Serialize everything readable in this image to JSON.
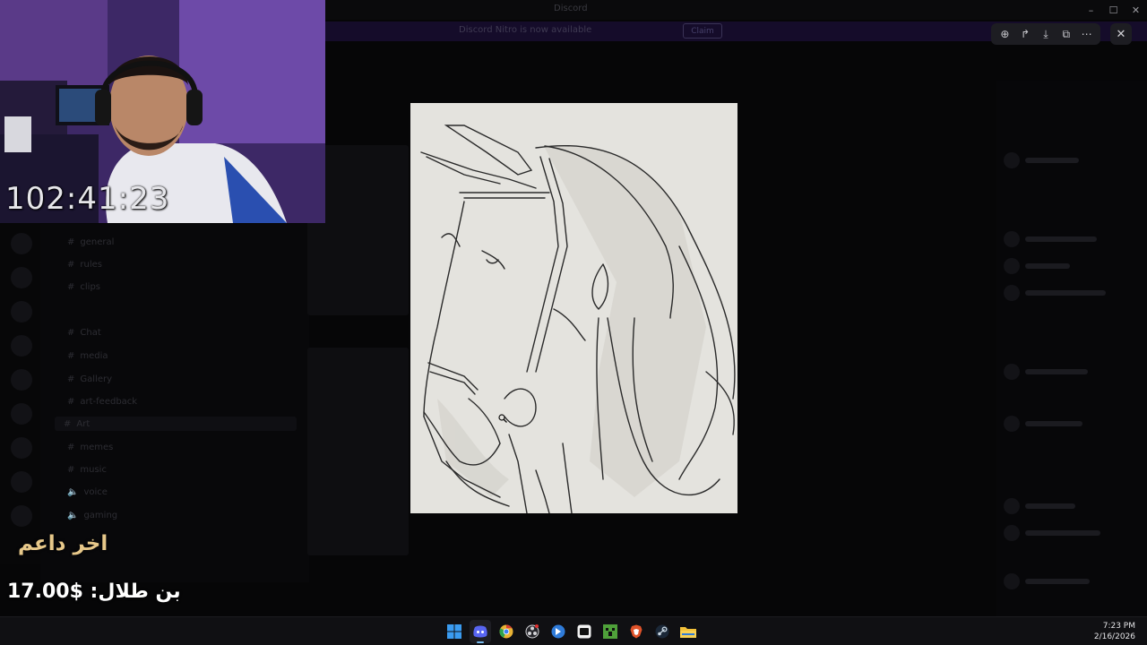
{
  "window": {
    "app_name": "Discord",
    "controls": [
      "minimize",
      "maximize",
      "close"
    ]
  },
  "banner": {
    "text": "Discord Nitro is now available",
    "button_label": "Claim"
  },
  "channels": [
    {
      "label": "general",
      "icon": "hash-icon"
    },
    {
      "label": "rules",
      "icon": "hash-icon"
    },
    {
      "label": "clips",
      "icon": "hash-icon"
    },
    {
      "label": "Chat",
      "icon": "hash-icon"
    },
    {
      "label": "media",
      "icon": "hash-icon"
    },
    {
      "label": "Gallery",
      "icon": "hash-icon"
    },
    {
      "label": "art-feedback",
      "icon": "hash-icon"
    },
    {
      "label": "Art",
      "icon": "hash-icon"
    },
    {
      "label": "memes",
      "icon": "hash-icon"
    },
    {
      "label": "music",
      "icon": "hash-icon"
    },
    {
      "label": "voice",
      "icon": "speaker-icon"
    },
    {
      "label": "gaming",
      "icon": "speaker-icon"
    }
  ],
  "viewer": {
    "tools": [
      {
        "icon": "zoom-in-icon",
        "glyph": "⊕"
      },
      {
        "icon": "share-icon",
        "glyph": "↱"
      },
      {
        "icon": "download-icon",
        "glyph": "⤓"
      },
      {
        "icon": "open-external-icon",
        "glyph": "⧉"
      },
      {
        "icon": "more-icon",
        "glyph": "⋯"
      }
    ],
    "close_glyph": "✕",
    "image_subject": "pencil sketch of a horse head"
  },
  "webcam": {
    "timer": "102:41:23"
  },
  "supporter": {
    "heading": "اخر داعم",
    "amount_line": "بن طلال: $17.00"
  },
  "taskbar": {
    "apps": [
      {
        "name": "windows-start-icon",
        "color": "#3a9bf0",
        "active": false
      },
      {
        "name": "discord-icon",
        "color": "#5865f2",
        "active": true
      },
      {
        "name": "chrome-icon",
        "color": "#e9b335",
        "active": false
      },
      {
        "name": "obs-icon",
        "color": "#d4d4d8",
        "active": false
      },
      {
        "name": "app-blue-icon",
        "color": "#2f7bd9",
        "active": false
      },
      {
        "name": "capcut-icon",
        "color": "#f2f2f2",
        "active": false
      },
      {
        "name": "minecraft-icon",
        "color": "#4fa13a",
        "active": false
      },
      {
        "name": "brave-icon",
        "color": "#e0532a",
        "active": false
      },
      {
        "name": "steam-icon",
        "color": "#c7d5e0",
        "active": false
      },
      {
        "name": "file-explorer-icon",
        "color": "#f3c13a",
        "active": false
      }
    ],
    "time": "7:23 PM",
    "date": "2/16/2026"
  }
}
